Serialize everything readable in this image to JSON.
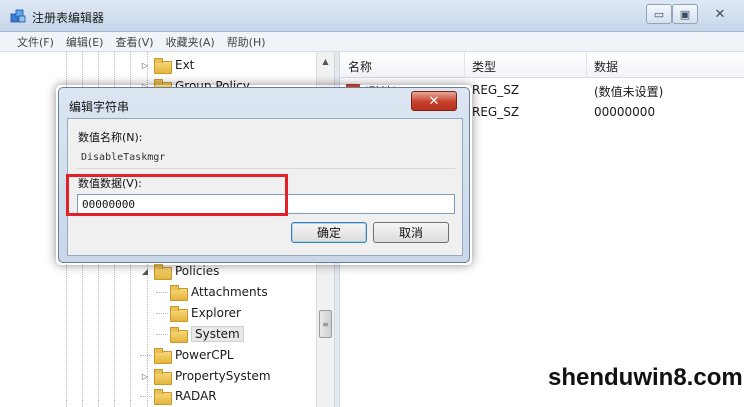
{
  "window": {
    "title": "注册表编辑器",
    "icon": "regedit-icon",
    "min_glyph": "▭",
    "max_glyph": "▣",
    "close_glyph": "✕"
  },
  "menu": [
    "文件(F)",
    "编辑(E)",
    "查看(V)",
    "收藏夹(A)",
    "帮助(H)"
  ],
  "tree": {
    "items": [
      {
        "label": "Ext",
        "expander": "▷"
      },
      {
        "label": "Group Policy",
        "expander": "▷"
      },
      {
        "label": "Policies",
        "expander": "◢"
      },
      {
        "label": "Attachments",
        "expander": ""
      },
      {
        "label": "Explorer",
        "expander": ""
      },
      {
        "label": "System",
        "expander": "",
        "selected": true
      },
      {
        "label": "PowerCPL",
        "expander": ""
      },
      {
        "label": "PropertySystem",
        "expander": "▷"
      },
      {
        "label": "RADAR",
        "expander": ""
      }
    ]
  },
  "list": {
    "headers": {
      "name": "名称",
      "type": "类型",
      "data": "数据"
    },
    "rows": [
      {
        "name": "(默认)",
        "type": "REG_SZ",
        "data": "(数值未设置)",
        "icon": "ab"
      },
      {
        "name": "",
        "type": "REG_SZ",
        "data": "00000000",
        "icon": "ab"
      }
    ]
  },
  "dialog": {
    "title": "编辑字符串",
    "close_glyph": "✕",
    "name_label": "数值名称(N):",
    "name_value": "DisableTaskmgr",
    "data_label": "数值数据(V):",
    "data_value": "00000000",
    "ok_label": "确定",
    "cancel_label": "取消"
  },
  "colors": {
    "highlight": "#e2202a",
    "dialog_close": "#c7402a"
  },
  "watermark": "shenduwin8.com"
}
